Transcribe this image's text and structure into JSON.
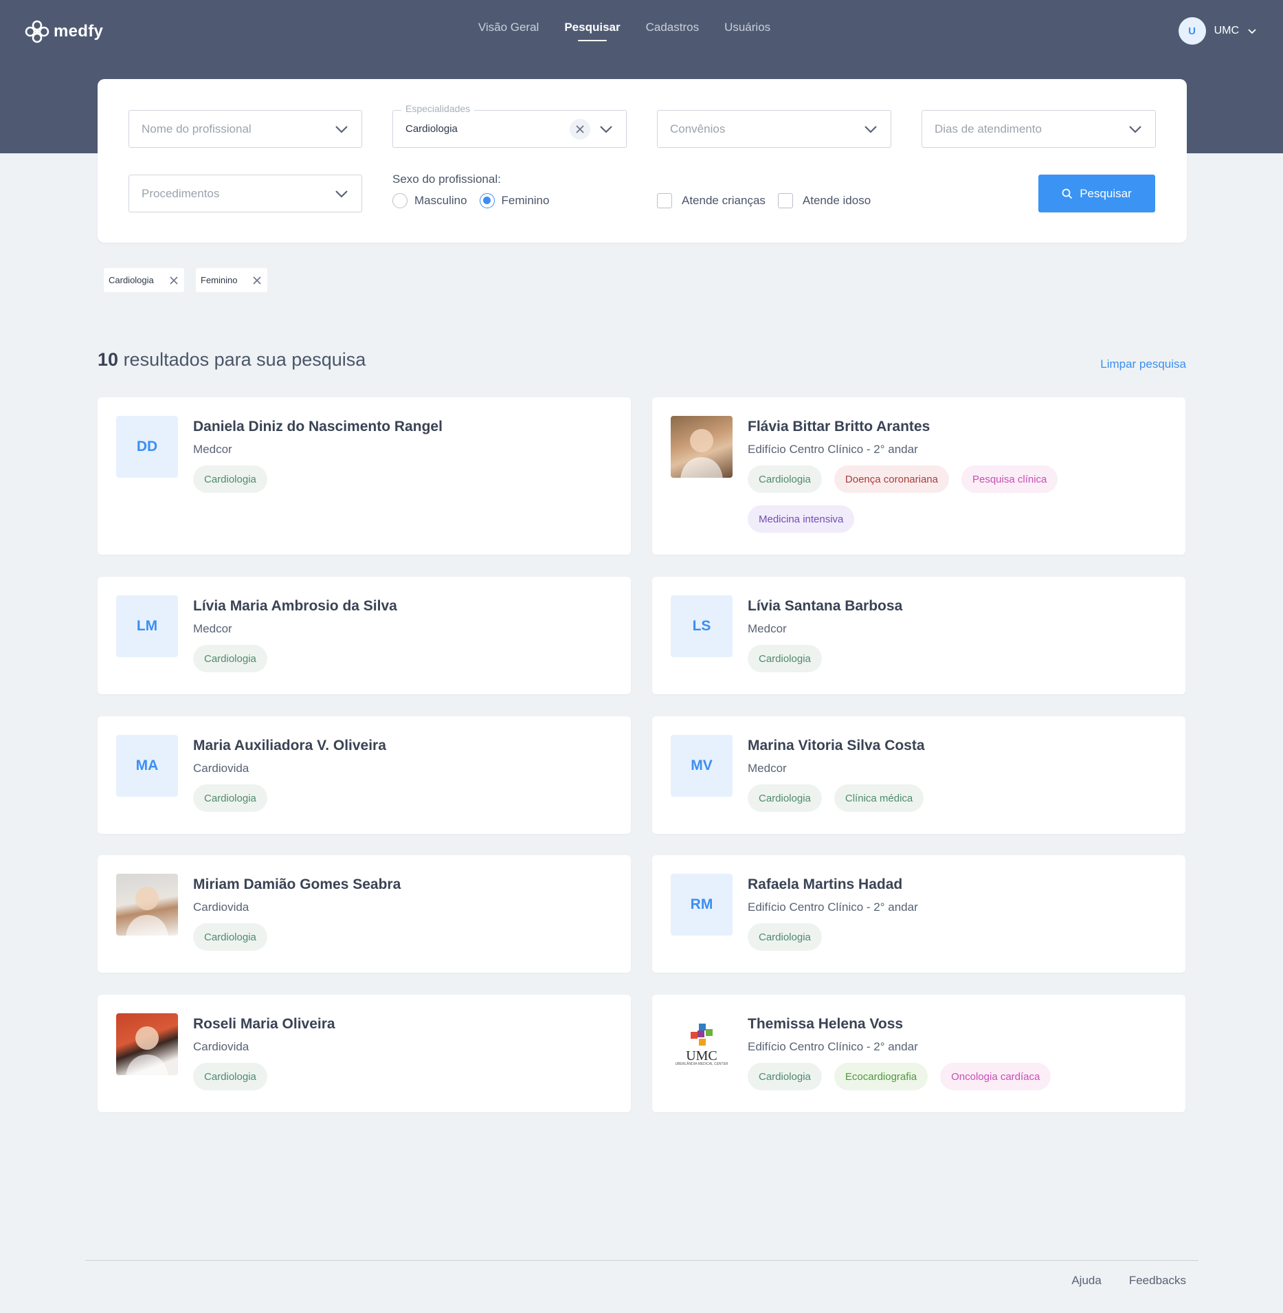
{
  "app": {
    "logo": "medfy"
  },
  "nav": {
    "items": [
      "Visão Geral",
      "Pesquisar",
      "Cadastros",
      "Usuários"
    ],
    "active": "Pesquisar"
  },
  "user": {
    "initial": "U",
    "name": "UMC"
  },
  "filters": {
    "profissional": {
      "placeholder": "Nome do profissional"
    },
    "especialidades": {
      "label": "Especialidades",
      "value": "Cardiologia"
    },
    "convenios": {
      "placeholder": "Convênios"
    },
    "dias": {
      "placeholder": "Dias de atendimento"
    },
    "procedimentos": {
      "placeholder": "Procedimentos"
    },
    "sexo": {
      "label": "Sexo do profissional:",
      "options": [
        "Masculino",
        "Feminino"
      ],
      "selected": "Feminino"
    },
    "criancas": {
      "label": "Atende crianças",
      "checked": false
    },
    "idoso": {
      "label": "Atende idoso",
      "checked": false
    },
    "search_label": "Pesquisar"
  },
  "chips": [
    "Cardiologia",
    "Feminino"
  ],
  "results": {
    "count": "10",
    "text": "resultados para sua pesquisa",
    "clear": "Limpar pesquisa"
  },
  "cards": [
    {
      "name": "Daniela Diniz do Nascimento Rangel",
      "place": "Medcor",
      "initials": "DD",
      "tags": [
        "Cardiologia"
      ]
    },
    {
      "name": "Flávia Bittar Britto Arantes",
      "place": "Edifício Centro Clínico - 2° andar",
      "photo": true,
      "tags": [
        "Cardiologia",
        "Doença coronariana",
        "Pesquisa clínica",
        "Medicina intensiva"
      ]
    },
    {
      "name": "Lívia Maria Ambrosio da Silva",
      "place": "Medcor",
      "initials": "LM",
      "tags": [
        "Cardiologia"
      ]
    },
    {
      "name": "Lívia Santana Barbosa",
      "place": "Medcor",
      "initials": "LS",
      "tags": [
        "Cardiologia"
      ]
    },
    {
      "name": "Maria Auxiliadora V. Oliveira",
      "place": "Cardiovida",
      "initials": "MA",
      "tags": [
        "Cardiologia"
      ]
    },
    {
      "name": "Marina Vitoria Silva Costa",
      "place": "Medcor",
      "initials": "MV",
      "tags": [
        "Cardiologia",
        "Clínica médica"
      ]
    },
    {
      "name": "Miriam Damião Gomes Seabra",
      "place": "Cardiovida",
      "photo": true,
      "tags": [
        "Cardiologia"
      ]
    },
    {
      "name": "Rafaela Martins Hadad",
      "place": "Edifício Centro Clínico - 2° andar",
      "initials": "RM",
      "tags": [
        "Cardiologia"
      ]
    },
    {
      "name": "Roseli Maria Oliveira",
      "place": "Cardiovida",
      "photo": true,
      "tags": [
        "Cardiologia"
      ]
    },
    {
      "name": "Themissa Helena Voss",
      "place": "Edifício Centro Clínico - 2° andar",
      "logo": true,
      "logo_text": "UMC",
      "logo_sub": "UBERLÂNDIA MEDICAL CENTER",
      "tags": [
        "Cardiologia",
        "Ecocardiografia",
        "Oncologia cardíaca"
      ]
    }
  ],
  "tag_colors": {
    "Cardiologia": "green",
    "Doença coronariana": "red",
    "Pesquisa clínica": "pink",
    "Medicina intensiva": "purple",
    "Clínica médica": "green",
    "Ecocardiografia": "lime",
    "Oncologia cardíaca": "pink"
  },
  "footer": {
    "help": "Ajuda",
    "feedback": "Feedbacks"
  }
}
